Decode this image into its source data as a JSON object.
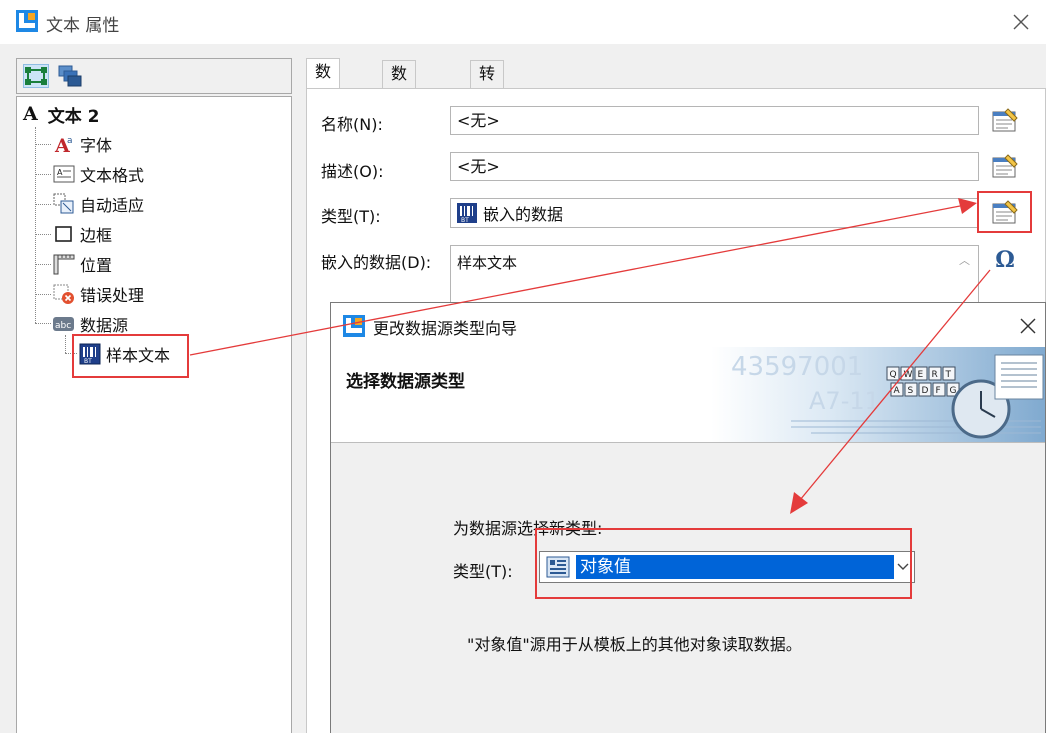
{
  "window": {
    "title": "文本 属性",
    "close_glyph": "✕"
  },
  "tree": {
    "root_label": "文本 2",
    "items": [
      {
        "label": "字体",
        "icon": "font-icon"
      },
      {
        "label": "文本格式",
        "icon": "text-format-icon"
      },
      {
        "label": "自动适应",
        "icon": "auto-fit-icon"
      },
      {
        "label": "边框",
        "icon": "border-icon"
      },
      {
        "label": "位置",
        "icon": "position-icon"
      },
      {
        "label": "错误处理",
        "icon": "error-handling-icon"
      },
      {
        "label": "数据源",
        "icon": "data-source-icon"
      }
    ],
    "child_label": "样本文本"
  },
  "tabs": [
    {
      "label": "数据源",
      "active": true
    },
    {
      "label": "数据类型",
      "active": false
    },
    {
      "label": "转换",
      "active": false
    }
  ],
  "form": {
    "name_label": "名称(N):",
    "name_value": "<无>",
    "desc_label": "描述(O):",
    "desc_value": "<无>",
    "type_label": "类型(T):",
    "type_value": "嵌入的数据",
    "embedded_label": "嵌入的数据(D):",
    "embedded_value": "样本文本",
    "omega_glyph": "Ω"
  },
  "wizard": {
    "title": "更改数据源类型向导",
    "heading": "选择数据源类型",
    "prompt": "为数据源选择新类型:",
    "type_label": "类型(T):",
    "selected_type": "对象值",
    "description": "\"对象值\"源用于从模板上的其他对象读取数据。",
    "banner_text": {
      "number": "43597001",
      "code": "A7-11",
      "keys_row1": [
        "Q",
        "W",
        "E",
        "R",
        "T"
      ],
      "keys_row2": [
        "A",
        "S",
        "D",
        "F",
        "G"
      ]
    }
  },
  "colors": {
    "highlight": "#e43b3b",
    "selection": "#0064d8",
    "logo_blue": "#1e88e5",
    "logo_orange": "#f5a623"
  }
}
